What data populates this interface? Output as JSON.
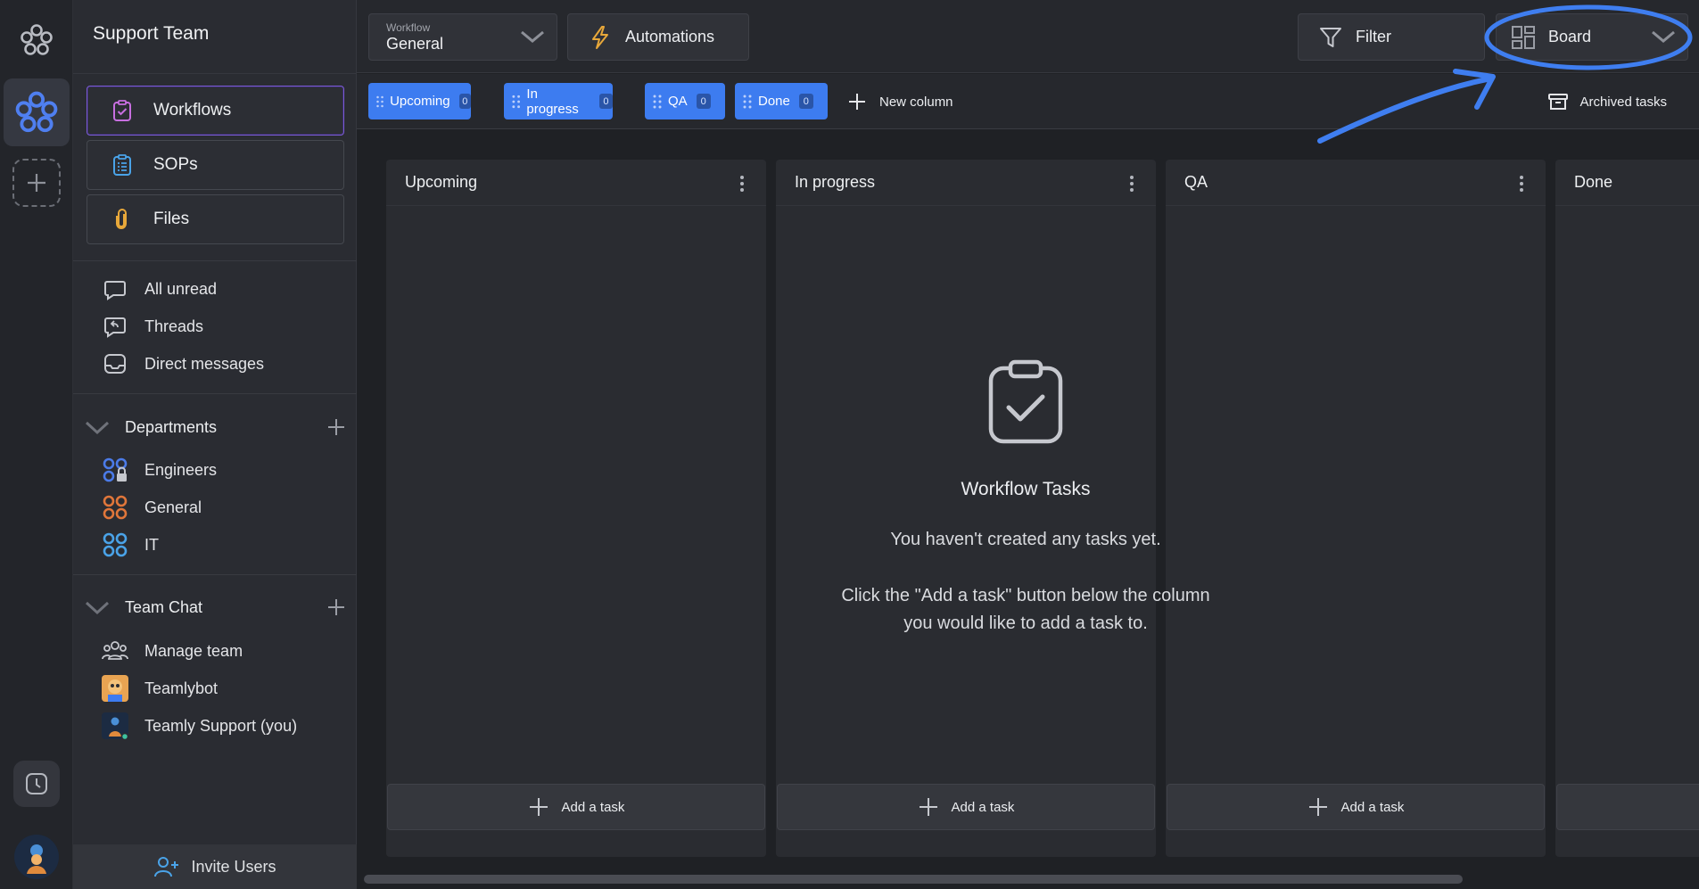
{
  "rail": {
    "logo_icon": "teamly-logo-icon",
    "active_icon": "workspace-flower-icon",
    "add_icon": "plus-icon",
    "clock_icon": "clock-icon",
    "avatar_icon": "user-avatar"
  },
  "sidebar": {
    "team_name": "Support Team",
    "nav": [
      {
        "label": "Workflows",
        "icon": "clipboard-check-icon",
        "active": true
      },
      {
        "label": "SOPs",
        "icon": "list-clipboard-icon",
        "active": false
      },
      {
        "label": "Files",
        "icon": "paperclip-icon",
        "active": false
      }
    ],
    "inbox": [
      {
        "label": "All unread",
        "icon": "chat-bubble-icon"
      },
      {
        "label": "Threads",
        "icon": "thread-reply-icon"
      },
      {
        "label": "Direct messages",
        "icon": "inbox-tray-icon"
      }
    ],
    "departments": {
      "title": "Departments",
      "items": [
        {
          "label": "Engineers",
          "icon": "department-lock-icon",
          "color": "#4b7be8"
        },
        {
          "label": "General",
          "icon": "department-icon",
          "color": "#e0763a"
        },
        {
          "label": "IT",
          "icon": "department-icon",
          "color": "#4aa3e8"
        }
      ]
    },
    "team_chat": {
      "title": "Team Chat",
      "items": [
        {
          "label": "Manage team",
          "icon": "team-group-icon"
        },
        {
          "label": "Teamlybot",
          "icon": "bot-avatar"
        },
        {
          "label": "Teamly Support (you)",
          "icon": "user-avatar"
        }
      ]
    },
    "invite_label": "Invite Users"
  },
  "topbar": {
    "workflow_caption": "Workflow",
    "workflow_value": "General",
    "automations_label": "Automations",
    "filter_label": "Filter",
    "view_label": "Board"
  },
  "tabbar": {
    "tabs": [
      {
        "label": "Upcoming",
        "count": "0"
      },
      {
        "label": "In progress",
        "count": "0"
      },
      {
        "label": "QA",
        "count": "0"
      },
      {
        "label": "Done",
        "count": "0"
      }
    ],
    "new_column_label": "New column",
    "archived_label": "Archived tasks"
  },
  "board": {
    "columns": [
      {
        "title": "Upcoming",
        "add_label": "Add a task"
      },
      {
        "title": "In progress",
        "add_label": "Add a task"
      },
      {
        "title": "QA",
        "add_label": "Add a task"
      },
      {
        "title": "Done",
        "add_label": ""
      }
    ],
    "empty_state": {
      "title": "Workflow Tasks",
      "line1": "You haven't created any tasks yet.",
      "line2a": "Click the \"Add a task\" button below the column",
      "line2b": "you would like to add a task to."
    }
  },
  "colors": {
    "accent_blue": "#3d7cf0",
    "active_border": "#7b5cd6",
    "annotation_blue": "#3f7ef0"
  }
}
